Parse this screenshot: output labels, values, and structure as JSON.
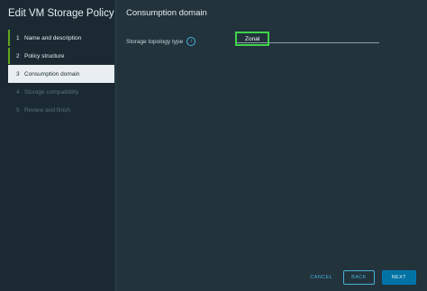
{
  "wizard": {
    "title": "Edit VM Storage Policy",
    "steps": [
      {
        "num": "1",
        "label": "Name and description",
        "state": "done"
      },
      {
        "num": "2",
        "label": "Policy structure",
        "state": "done"
      },
      {
        "num": "3",
        "label": "Consumption domain",
        "state": "active"
      },
      {
        "num": "4",
        "label": "Storage compatibility",
        "state": "disabled"
      },
      {
        "num": "5",
        "label": "Review and finish",
        "state": "disabled"
      }
    ]
  },
  "main": {
    "title": "Consumption domain",
    "field": {
      "label": "Storage topology type",
      "info_icon": "info-circle-icon",
      "value": "Zonal"
    }
  },
  "footer": {
    "cancel_label": "CANCEL",
    "back_label": "BACK",
    "next_label": "NEXT"
  },
  "colors": {
    "accent": "#49afd9",
    "primary": "#0072a3",
    "done_bar": "#62a420",
    "highlight_box": "#3fd44a"
  }
}
